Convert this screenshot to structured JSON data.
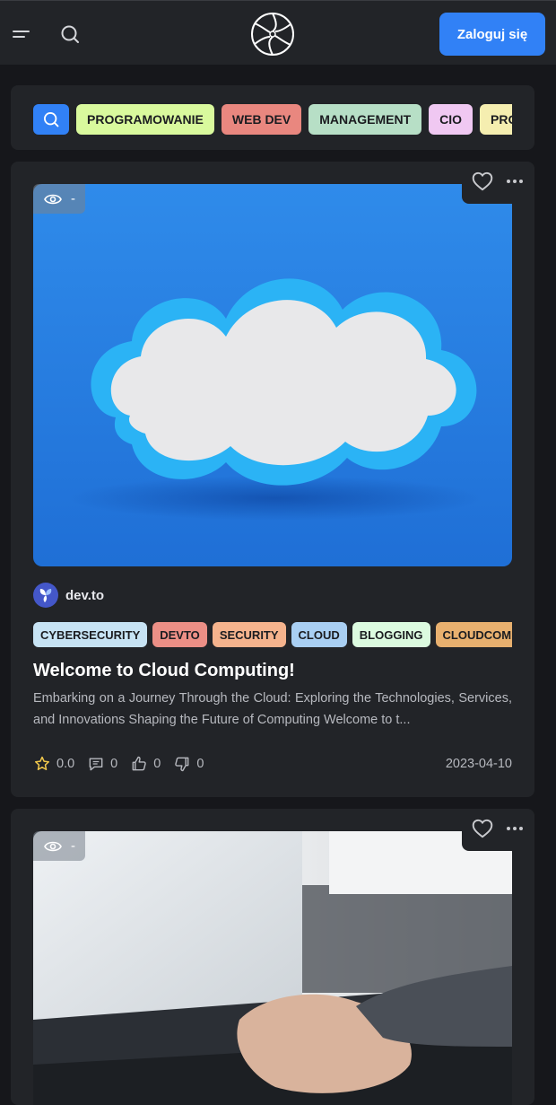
{
  "header": {
    "login_label": "Zaloguj się",
    "icons": [
      "menu-icon",
      "search-icon",
      "logo"
    ]
  },
  "categories": {
    "items": [
      {
        "label": "PROGRAMOWANIE",
        "color": "#d9f99d"
      },
      {
        "label": "WEB DEV",
        "color": "#e9877f"
      },
      {
        "label": "MANAGEMENT",
        "color": "#b7dfc6"
      },
      {
        "label": "CIO",
        "color": "#f0c8f2"
      },
      {
        "label": "PROJECT",
        "color": "#f5eeb0"
      }
    ]
  },
  "posts": [
    {
      "views": "-",
      "source": "dev.to",
      "tags": [
        {
          "label": "CYBERSECURITY",
          "color": "#c7e3f4"
        },
        {
          "label": "DEVTO",
          "color": "#ec8f86"
        },
        {
          "label": "SECURITY",
          "color": "#f5b38d"
        },
        {
          "label": "CLOUD",
          "color": "#a9cff3"
        },
        {
          "label": "BLOGGING",
          "color": "#dcfbe0"
        },
        {
          "label": "CLOUDCOMPUTING",
          "color": "#e8b06f"
        }
      ],
      "title": "Welcome to Cloud Computing!",
      "description": "Embarking on a Journey Through the Cloud: Exploring the Technologies, Services, and Innovations Shaping the Future of Computing Welcome to t...",
      "rating": "0.0",
      "comments": "0",
      "likes": "0",
      "dislikes": "0",
      "date": "2023-04-10"
    },
    {
      "views": "-"
    }
  ]
}
